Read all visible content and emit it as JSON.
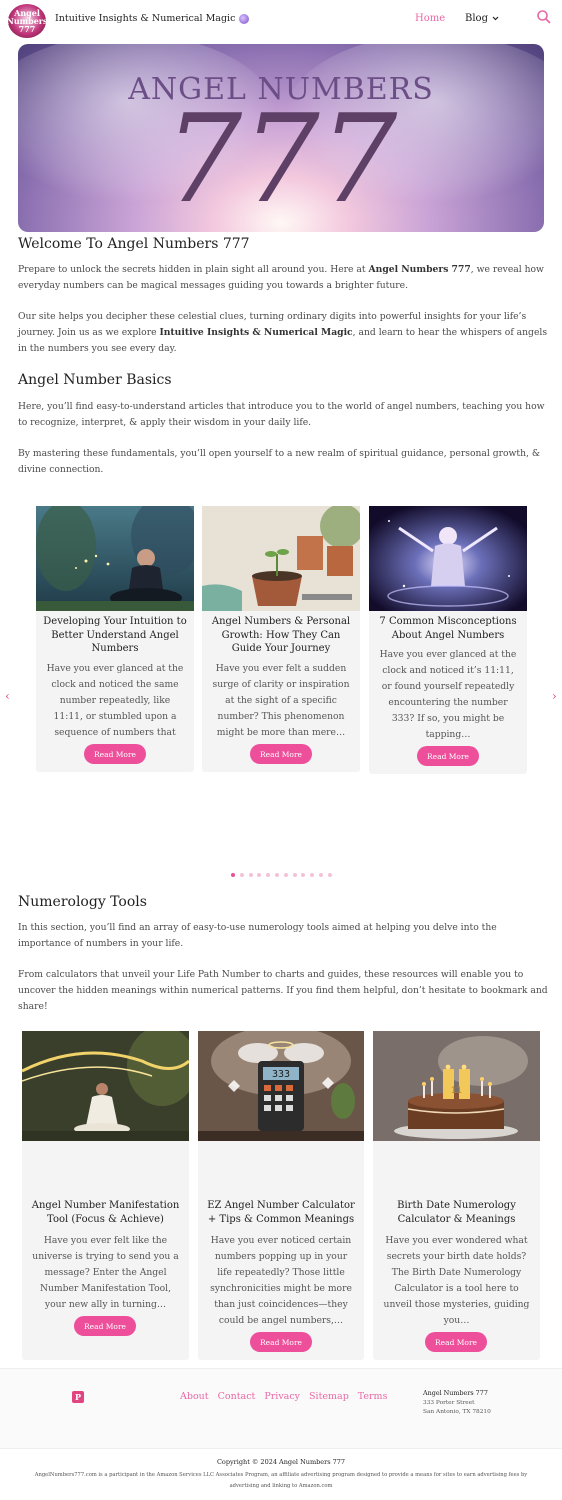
{
  "header": {
    "logo_text": "Angel Numbers 777",
    "tagline": "Intuitive Insights & Numerical Magic",
    "nav": {
      "home": "Home",
      "blog": "Blog"
    }
  },
  "hero": {
    "title": "ANGEL NUMBERS",
    "number": "777"
  },
  "welcome": {
    "heading": "Welcome To Angel Numbers 777",
    "p1_a": "Prepare to unlock the secrets hidden in plain sight all around you. Here at ",
    "p1_b": "Angel Numbers 777",
    "p1_c": ", we reveal how everyday numbers can be magical messages guiding you towards a brighter future.",
    "p2_a": "Our site helps you decipher these celestial clues, turning ordinary digits into powerful insights for your life’s journey. Join us as we explore ",
    "p2_b": "Intuitive Insights & Numerical Magic",
    "p2_c": ", and learn to hear the whispers of angels in the numbers you see every day."
  },
  "basics": {
    "heading": "Angel Number Basics",
    "p1": "Here, you’ll find easy-to-understand articles that introduce you to the world of angel numbers, teaching you how to recognize, interpret, & apply their wisdom in your daily life.",
    "p2": "By mastering these fundamentals, you’ll open yourself to a new realm of spiritual guidance, personal growth, & divine connection."
  },
  "carousel": {
    "prev": "‹",
    "next": "›",
    "cards": [
      {
        "title": "Developing Your Intuition to Better Understand Angel Numbers",
        "desc": "Have you ever glanced at the clock and noticed the same number repeatedly, like 11:11, or stumbled upon a sequence of numbers that seemed to…",
        "button": "Read More"
      },
      {
        "title": "Angel Numbers & Personal Growth: How They Can Guide Your Journey",
        "desc": "Have you ever felt a sudden surge of clarity or inspiration at the sight of a specific number? This phenomenon might be more than mere…",
        "button": "Read More"
      },
      {
        "title": "7 Common Misconceptions About Angel Numbers",
        "desc": "Have you ever glanced at the clock and noticed it’s 11:11, or found yourself repeatedly encountering the number 333? If so, you might be tapping…",
        "button": "Read More"
      }
    ],
    "active_dot": 0,
    "dot_count": 12
  },
  "tools": {
    "heading": "Numerology Tools",
    "p1": "In this section, you’ll find an array of easy-to-use numerology tools aimed at helping you delve into the importance of numbers in your life.",
    "p2": "From calculators that unveil your Life Path Number to charts and guides, these resources will enable you to uncover the hidden meanings within numerical patterns. If you find them helpful, don’t hesitate to bookmark and share!",
    "cards": [
      {
        "title": "Angel Number Manifestation Tool (Focus & Achieve)",
        "desc": "Have you ever felt like the universe is trying to send you a message? Enter the Angel Number Manifestation Tool, your new ally in turning…",
        "button": "Read More"
      },
      {
        "title": "EZ Angel Number Calculator + Tips & Common Meanings",
        "desc": "Have you ever noticed certain numbers popping up in your life repeatedly? Those little synchronicities might be more than just coincidences—they could be angel numbers,…",
        "button": "Read More",
        "screen": "333"
      },
      {
        "title": "Birth Date Numerology Calculator & Meanings",
        "desc": "Have you ever wondered what secrets your birth date holds? The Birth Date Numerology Calculator is a tool here to unveil those mysteries, guiding you…",
        "button": "Read More",
        "candles": "11"
      }
    ]
  },
  "footer": {
    "pin": "P",
    "links": [
      "About",
      "Contact",
      "Privacy",
      "Sitemap",
      "Terms"
    ],
    "address": {
      "name": "Angel Numbers 777",
      "street": "333 Porter Street",
      "city": "San Antonio, TX 78210"
    },
    "copyright": "Copyright © 2024 Angel Numbers 777",
    "disclaimer": "AngelNumbers777.com is a participant in the Amazon Services LLC Associates Program, an affiliate advertising program designed to provide a means for sites to earn advertising fees by advertising and linking to Amazon.com"
  },
  "colors": {
    "accent": "#ed4f9a",
    "link": "#e86aa6",
    "card_bg": "#f4f4f5"
  }
}
